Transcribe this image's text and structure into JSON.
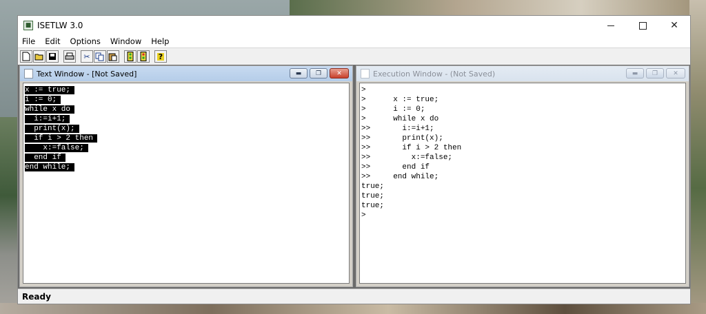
{
  "app": {
    "title": "ISETLW 3.0"
  },
  "menu": [
    "File",
    "Edit",
    "Options",
    "Window",
    "Help"
  ],
  "toolbar": {
    "buttons": [
      "new-file-icon",
      "open-folder-icon",
      "save-disk-icon",
      "print-icon",
      "cut-scissors-icon",
      "copy-icon",
      "paste-icon",
      "run-traffic-light-icon",
      "stop-traffic-light-icon",
      "help-question-icon"
    ]
  },
  "text_window": {
    "title": "Text Window - [Not Saved]",
    "lines": [
      "x := true;",
      "i := 0;",
      "while x do",
      "  i:=i+1;",
      "  print(x);",
      "  if i > 2 then",
      "    x:=false;",
      "  end if",
      "end while;"
    ]
  },
  "exec_window": {
    "title": "Execution Window - (Not Saved)",
    "lines": [
      ">",
      ">      x := true;",
      ">      i := 0;",
      ">      while x do",
      ">>       i:=i+1;",
      ">>       print(x);",
      ">>       if i > 2 then",
      ">>         x:=false;",
      ">>       end if",
      ">>     end while;",
      "true;",
      "true;",
      "true;",
      ">"
    ]
  },
  "status": {
    "text": "Ready"
  },
  "colors": {
    "selection_bg": "#000000",
    "active_title": "#b5cde9",
    "close_button": "#c8402b"
  }
}
